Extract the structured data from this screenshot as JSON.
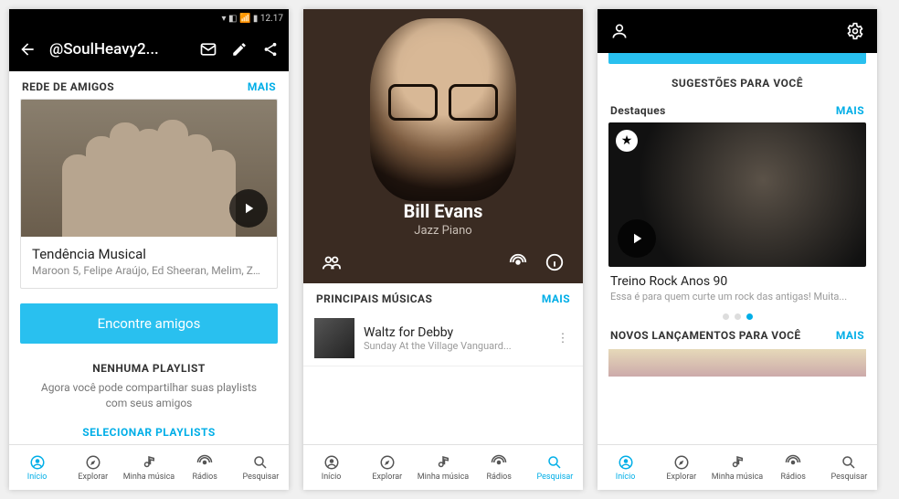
{
  "accent": "#00aee7",
  "more_label": "MAIS",
  "nav": {
    "inicio": "Início",
    "explorar": "Explorar",
    "minha": "Minha música",
    "radios": "Rádios",
    "pesquisar": "Pesquisar"
  },
  "s1": {
    "username": "@SoulHeavy2...",
    "section": "REDE DE AMIGOS",
    "card_title": "Tendência Musical",
    "card_sub": "Maroon 5, Felipe Araújo, Ed Sheeran, Melim, Zé...",
    "find_friends": "Encontre amigos",
    "no_playlist_h": "NENHUMA PLAYLIST",
    "no_playlist_p": "Agora você pode compartilhar suas playlists com seus amigos",
    "select_pl": "SELECIONAR PLAYLISTS",
    "active_tab": "inicio"
  },
  "s2": {
    "artist": "Bill Evans",
    "genre": "Jazz Piano",
    "section": "PRINCIPAIS MÚSICAS",
    "song": "Waltz for Debby",
    "album": "Sunday At the Village Vanguard...",
    "active_tab": "pesquisar"
  },
  "s3": {
    "sugg": "SUGESTÕES PARA VOCÊ",
    "destaques": "Destaques",
    "card_title": "Treino Rock Anos 90",
    "card_sub": "Essa é para quem curte um rock das antigas! Muita...",
    "novos": "NOVOS LANÇAMENTOS PARA VOCÊ",
    "active_tab": "inicio"
  }
}
